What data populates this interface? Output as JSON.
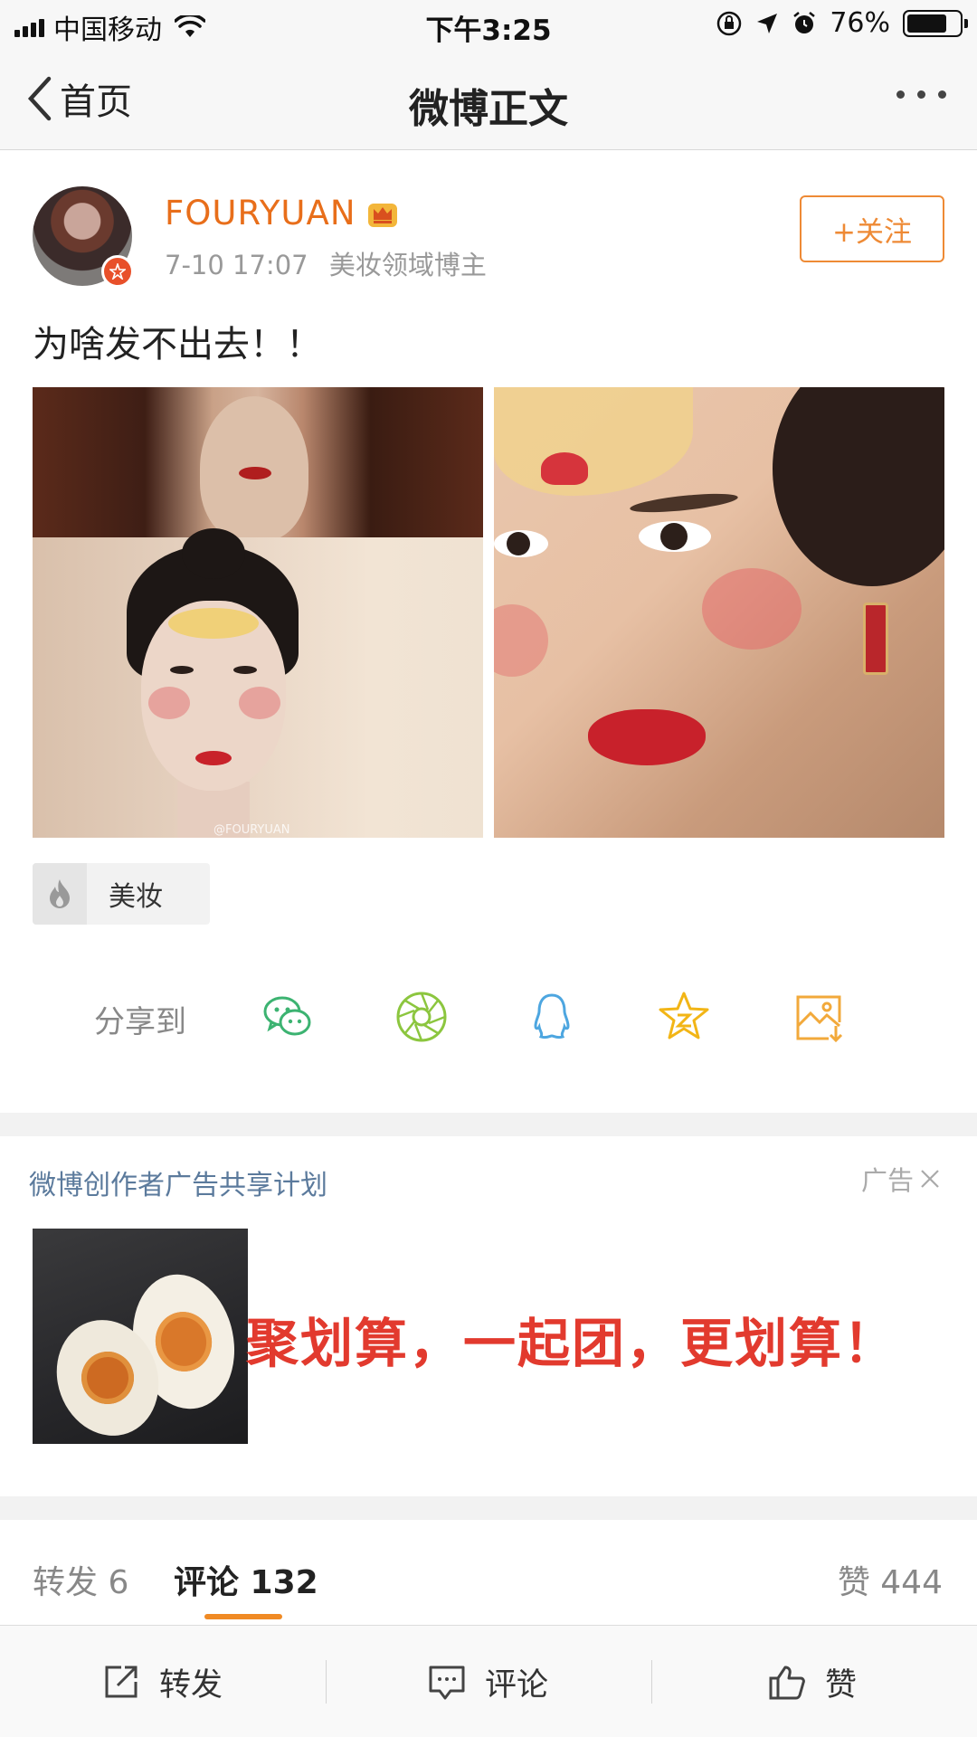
{
  "status_bar": {
    "carrier": "中国移动",
    "time": "下午3:25",
    "battery_percent": "76%",
    "battery_level": 0.76
  },
  "nav": {
    "back_label": "首页",
    "title": "微博正文"
  },
  "post": {
    "author": "FOURYUAN",
    "timestamp": "7-10 17:07",
    "author_tag": "美妆领域博主",
    "follow_label": "+关注",
    "text": "为啥发不出去！！",
    "image_watermark": "@FOURYUAN",
    "topic": "美妆"
  },
  "share": {
    "label": "分享到",
    "targets": [
      "wechat-icon",
      "moments-icon",
      "qq-icon",
      "qzone-icon",
      "save-image-icon"
    ]
  },
  "ad": {
    "title": "微博创作者广告共享计划",
    "label": "广告",
    "slogan": "聚划算，一起团，更划算！"
  },
  "stats": {
    "repost_label": "转发 6",
    "comment_label": "评论 132",
    "like_label": "赞 444"
  },
  "toolbar": {
    "repost": "转发",
    "comment": "评论",
    "like": "赞"
  },
  "colors": {
    "accent": "#ee8a35",
    "username": "#e86e1a",
    "ad_title": "#5b7a9c",
    "ad_slogan": "#e23a2e"
  }
}
